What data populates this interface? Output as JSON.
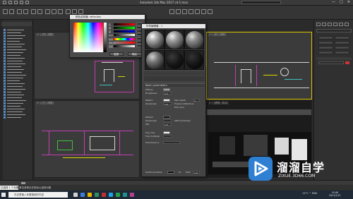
{
  "window": {
    "title": "Autodesk 3ds Max 2017   cd-1.max",
    "controls": [
      "—",
      "□",
      "✕"
    ]
  },
  "viewports": {
    "top_left_label": "[+] [顶] [线框]",
    "top_right_label": "[+] [前] [线框]",
    "bottom_left_label": "[+] [左] [线框]",
    "bottom_right_label": "[+] [透视] [真实]"
  },
  "color_dialog": {
    "title": "颜色选择器: reflection",
    "slider_labels": [
      "红",
      "绿",
      "蓝",
      "Alpha",
      "色调",
      "饱和度",
      "亮度"
    ],
    "reset_label": "重置",
    "ok_label": "确定"
  },
  "material_editor": {
    "title": "材质编辑器 - 1",
    "section_basic": "Basic parameters",
    "diffuse": "Diffuse",
    "roughness": "Roughness",
    "reflect": "Reflect",
    "glossiness": "Glossiness",
    "fresnel": "Fresnel reflections",
    "refract": "Refract",
    "ior": "IOR",
    "fog_color": "Fog color",
    "fog_multiplier": "Fog multiplier",
    "translucency": "Translucency",
    "self_illum": "Self-illumination",
    "max_depth": "Max depth",
    "exit_color": "Exit color",
    "affect_shadows": "Affect shadows",
    "gi": "GI",
    "mult": "Mult",
    "values": {
      "roughness": "0.0",
      "glossiness": "1.0",
      "max_depth": "5",
      "ior": "1.6",
      "mult": "1.0"
    }
  },
  "status": {
    "message": "已选择 1 个对象",
    "hint": "单击或单击并拖动以选择对象"
  },
  "taskbar": {
    "search_placeholder": "在这里输入你要搜索的内容",
    "tray": "11°C  ^  ENG",
    "time": "10:46",
    "date": "2021/1/15"
  },
  "watermark": {
    "text": "溜溜自学",
    "url": "ZIXUE.3D66.COM"
  }
}
